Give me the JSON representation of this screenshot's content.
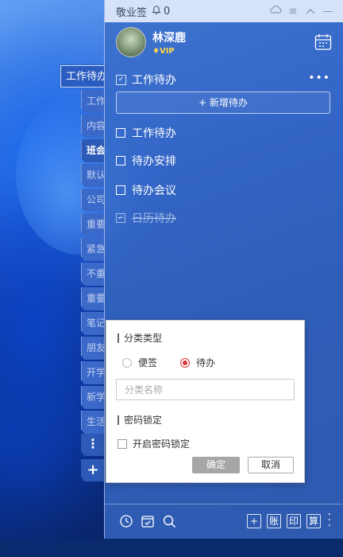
{
  "titlebar": {
    "app_name": "敬业签",
    "notification_count": "0",
    "icons": [
      "cloud-sync-icon",
      "menu-icon",
      "collapse-icon",
      "minimize-icon"
    ]
  },
  "user": {
    "name": "林深鹿",
    "badge": "VIP"
  },
  "left_tabs": {
    "active": "工作待办",
    "items": [
      "工作",
      "内容",
      "班会",
      "默认",
      "公司",
      "重要",
      "紧急",
      "不重",
      "重要",
      "笔记",
      "朋友",
      "开学",
      "新学",
      "生活"
    ],
    "more_icon": "more-vertical-icon",
    "add_icon": "plus-icon"
  },
  "section": {
    "title": "工作待办",
    "add_label": "+ 新增待办"
  },
  "todos": [
    {
      "text": "工作待办",
      "done": false
    },
    {
      "text": "待办安排",
      "done": false
    },
    {
      "text": "待办会议",
      "done": false
    },
    {
      "text": "日历待办",
      "done": true
    }
  ],
  "dialog": {
    "type_label": "分类类型",
    "option_note": "便签",
    "option_todo": "待办",
    "selected": "待办",
    "name_placeholder": "分类名称",
    "lock_label": "密码锁定",
    "lock_checkbox": "开启密码锁定",
    "ok": "确定",
    "cancel": "取消"
  },
  "bottombar": {
    "add": "+",
    "account": "账",
    "print": "印",
    "calc": "算"
  },
  "colors": {
    "panel": "#3a6cc6",
    "accent_red": "#dd3333"
  }
}
